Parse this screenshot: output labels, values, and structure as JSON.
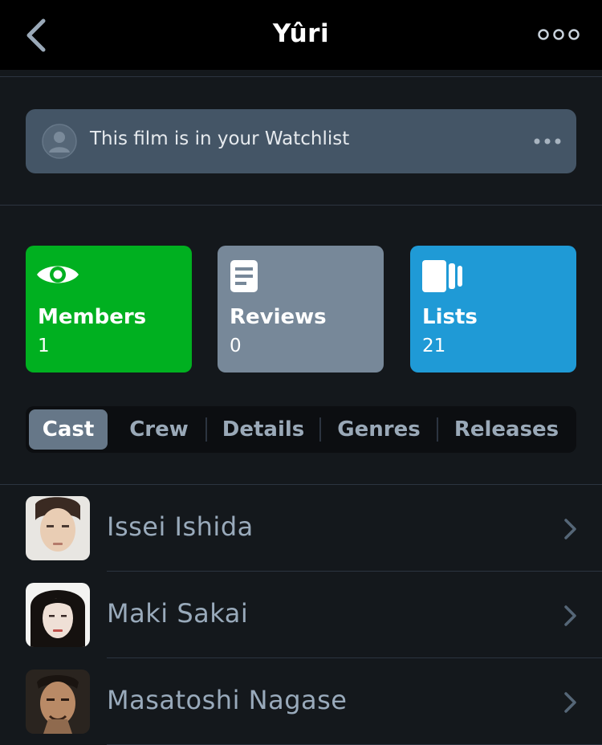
{
  "header": {
    "title": "Yûri",
    "back_icon": "chevron-left-icon",
    "more_icon": "ellipsis-icon"
  },
  "watchlist": {
    "text": "This film is in your Watchlist",
    "avatar_icon": "person-icon",
    "more_icon": "ellipsis-icon"
  },
  "stats": {
    "members": {
      "label": "Members",
      "value": "1",
      "icon": "eye-icon",
      "color": "#00b020"
    },
    "reviews": {
      "label": "Reviews",
      "value": "0",
      "icon": "document-icon",
      "color": "#778899"
    },
    "lists": {
      "label": "Lists",
      "value": "21",
      "icon": "lists-icon",
      "color": "#1f9ad6"
    }
  },
  "tabs": [
    {
      "label": "Cast",
      "active": true
    },
    {
      "label": "Crew",
      "active": false
    },
    {
      "label": "Details",
      "active": false
    },
    {
      "label": "Genres",
      "active": false
    },
    {
      "label": "Releases",
      "active": false
    }
  ],
  "cast": [
    {
      "name": "Issei Ishida"
    },
    {
      "name": "Maki Sakai"
    },
    {
      "name": "Masatoshi Nagase"
    }
  ]
}
